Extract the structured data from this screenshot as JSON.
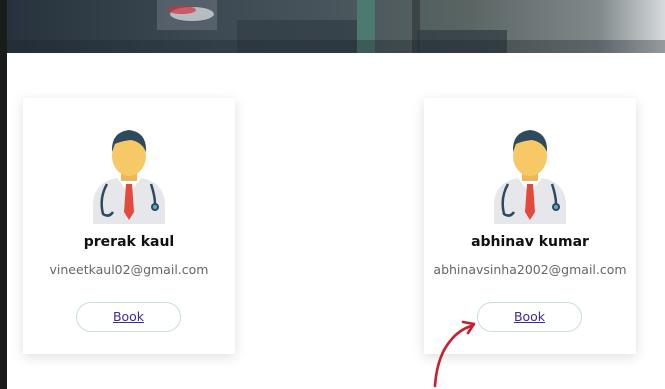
{
  "doctors": [
    {
      "name": "prerak kaul",
      "email": "vineetkaul02@gmail.com",
      "book_label": "Book"
    },
    {
      "name": "abhinav kumar",
      "email": "abhinavsinha2002@gmail.com",
      "book_label": "Book"
    }
  ],
  "icons": {
    "avatar": "doctor-avatar-icon",
    "arrow": "annotation-arrow-icon"
  },
  "colors": {
    "accent": "#3a2aa0",
    "arrow": "#c81e2e",
    "button_border": "#c9dedd"
  }
}
